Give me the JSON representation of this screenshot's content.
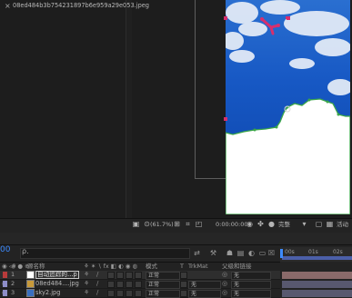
{
  "viewer": {
    "zoom": "(61.7%)",
    "timecode": "0:00:00:00",
    "quality": "完整",
    "active_camera": "活动"
  },
  "timeline": {
    "tab_label": "08ed484b3b754231897b6e959a29e053.jpeg",
    "timecode": "00",
    "search_placeholder": "ρ.",
    "ruler_labels": [
      "00s",
      "01s",
      "02s"
    ],
    "columns": {
      "source_name": "源名称",
      "mode": "模式",
      "t": "T",
      "trkmat": "TrkMat",
      "parent": "父级和链接"
    },
    "layers": [
      {
        "num": "1",
        "name": "自动追踪的…p",
        "mode": "正常",
        "trkmat": "",
        "parent": "无",
        "color": "#b83b3b",
        "selected": true
      },
      {
        "num": "2",
        "name": "08ed484....jpg",
        "mode": "正常",
        "trkmat": "无",
        "parent": "无",
        "color": "#8e8ec8",
        "selected": false
      },
      {
        "num": "3",
        "name": "sky2.jpg",
        "mode": "正常",
        "trkmat": "无",
        "parent": "无",
        "color": "#8e8ec8",
        "selected": false
      }
    ]
  },
  "colors": {
    "accent": "#3d8bff",
    "sky": "#1f63c2",
    "track_handle": "#d72f6d",
    "mask_green": "#3aa648"
  }
}
